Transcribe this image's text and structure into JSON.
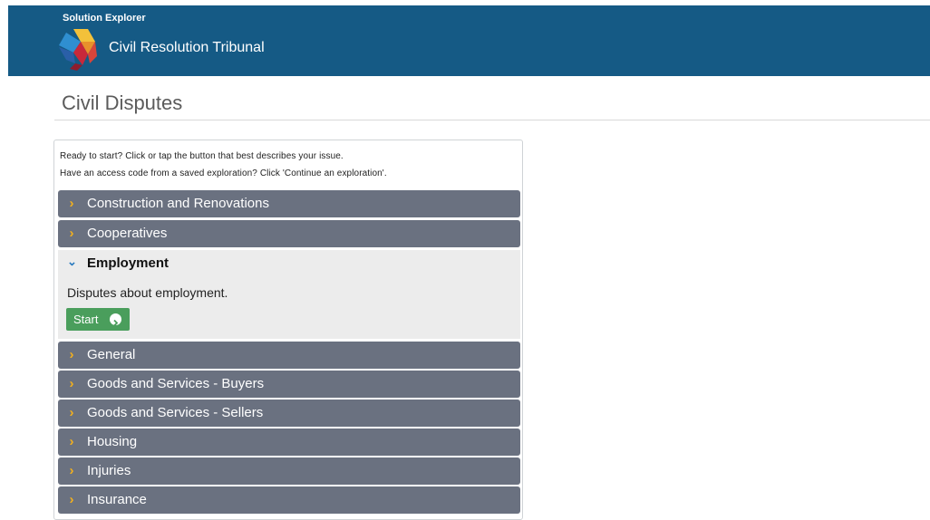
{
  "header": {
    "app_name": "Solution Explorer",
    "org_name": "Civil Resolution Tribunal"
  },
  "page": {
    "title": "Civil Disputes"
  },
  "panel": {
    "intro_line1": "Ready to start? Click or tap the button that best describes your issue.",
    "intro_line2": "Have an access code from a saved exploration? Click 'Continue an exploration'.",
    "categories": [
      {
        "label": "Construction and Renovations",
        "chevron": "›"
      },
      {
        "label": "Cooperatives",
        "chevron": "›"
      },
      {
        "label": "Employment",
        "chevron": "⌄",
        "description": "Disputes about employment.",
        "start_label": "Start"
      },
      {
        "label": "General",
        "chevron": "›"
      },
      {
        "label": "Goods and Services - Buyers",
        "chevron": "›"
      },
      {
        "label": "Goods and Services - Sellers",
        "chevron": "›"
      },
      {
        "label": "Housing",
        "chevron": "›"
      },
      {
        "label": "Injuries",
        "chevron": "›"
      },
      {
        "label": "Insurance",
        "chevron": "›"
      }
    ]
  },
  "colors": {
    "header_bg": "#155a85",
    "category_bg": "#6a7180",
    "chevron": "#f2b01e",
    "start_button": "#4a9e5c"
  },
  "icons": {
    "logo": "hexagon-logo-icon",
    "category_chevron": "chevron-right-icon",
    "expanded_chevron": "chevron-down-icon",
    "start": "play-circle-icon"
  }
}
